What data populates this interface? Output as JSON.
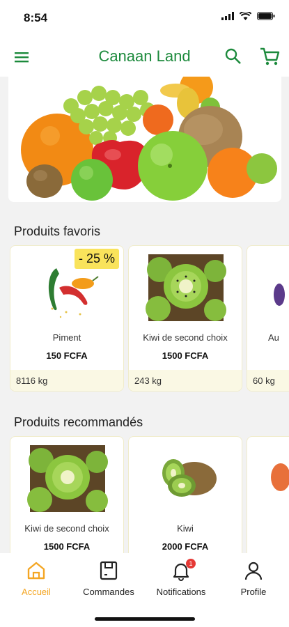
{
  "status_bar": {
    "time": "8:54"
  },
  "app_bar": {
    "title": "Canaan Land"
  },
  "sections": {
    "favorites_title": "Produits favoris",
    "recommended_title": "Produits recommandés"
  },
  "favorites": [
    {
      "name": "Piment",
      "price": "150 FCFA",
      "stock": "8116 kg",
      "discount": "- 25 %"
    },
    {
      "name": "Kiwi de second choix",
      "price": "1500 FCFA",
      "stock": "243 kg"
    },
    {
      "name": "Au",
      "price": "",
      "stock": "60 kg"
    }
  ],
  "recommended": [
    {
      "name": "Kiwi de second choix",
      "price": "1500 FCFA"
    },
    {
      "name": "Kiwi",
      "price": "2000 FCFA"
    }
  ],
  "bottom_nav": {
    "items": [
      {
        "label": "Accueil",
        "icon": "home-icon"
      },
      {
        "label": "Commandes",
        "icon": "orders-icon"
      },
      {
        "label": "Notifications",
        "icon": "bell-icon",
        "badge": "1"
      },
      {
        "label": "Profile",
        "icon": "profile-icon"
      }
    ],
    "active_color": "#f4a623"
  },
  "colors": {
    "brand_green": "#1c8a3c",
    "accent": "#f4a623",
    "discount_bg": "#f9e35b"
  }
}
